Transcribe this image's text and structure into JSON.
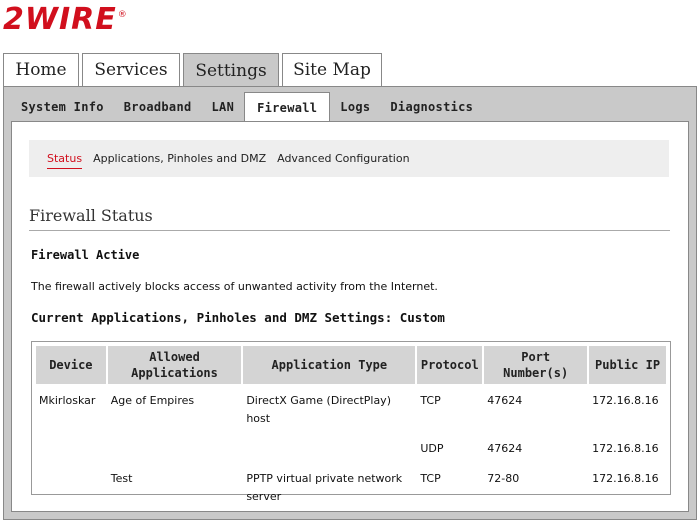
{
  "logo": {
    "text": "2WIRE",
    "mark": "®"
  },
  "main_tabs": [
    {
      "label": "Home"
    },
    {
      "label": "Services"
    },
    {
      "label": "Settings"
    },
    {
      "label": "Site Map"
    }
  ],
  "sub_tabs": [
    {
      "label": "System Info"
    },
    {
      "label": "Broadband"
    },
    {
      "label": "LAN"
    },
    {
      "label": "Firewall"
    },
    {
      "label": "Logs"
    },
    {
      "label": "Diagnostics"
    }
  ],
  "subnav": [
    {
      "label": "Status"
    },
    {
      "label": "Applications, Pinholes and DMZ"
    },
    {
      "label": "Advanced Configuration"
    }
  ],
  "section_title": "Firewall Status",
  "firewall_state": "Firewall Active",
  "description": "The firewall actively blocks access of unwanted activity from the Internet.",
  "current_settings": "Current Applications, Pinholes and DMZ Settings: Custom",
  "table": {
    "headers": [
      "Device",
      "Allowed Applications",
      "Application Type",
      "Protocol",
      "Port Number(s)",
      "Public IP"
    ],
    "rows": [
      [
        "Mkirloskar",
        "Age of Empires",
        "DirectX Game (DirectPlay) host",
        "TCP",
        "47624",
        "172.16.8.16"
      ],
      [
        "",
        "",
        "",
        "UDP",
        "47624",
        "172.16.8.16"
      ],
      [
        "",
        "Test",
        "PPTP virtual private network server",
        "TCP",
        "72-80",
        "172.16.8.16"
      ]
    ]
  },
  "colors": {
    "brand": "#d10f1d",
    "tab_active_bg": "#c9c9c9",
    "header_bg": "#d4d4d4"
  }
}
